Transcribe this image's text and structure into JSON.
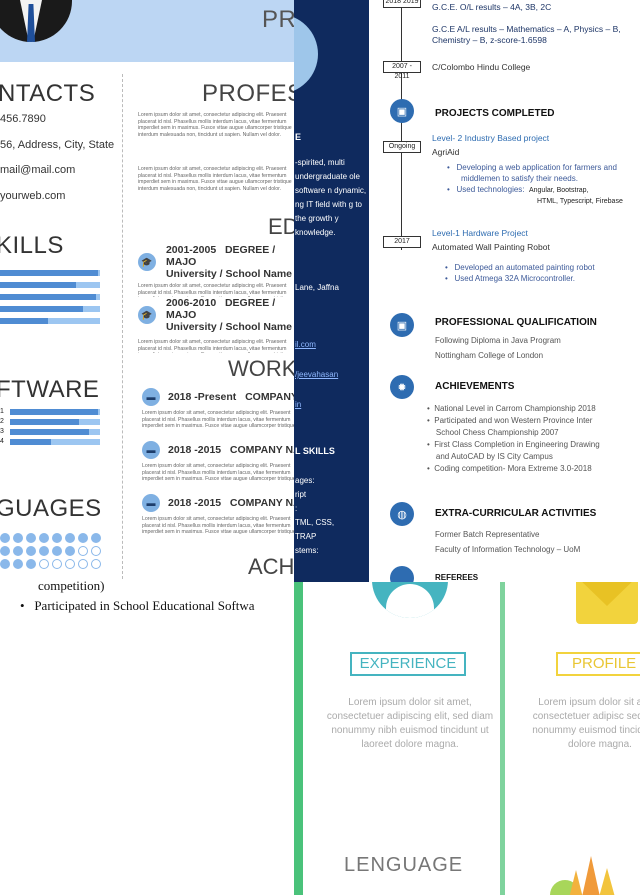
{
  "left_resume": {
    "top_label": "PR",
    "contacts_heading": "NTACTS",
    "phone": "456.7890",
    "address": "56, Address, City, State",
    "email": "mail@mail.com",
    "website": "yourweb.com",
    "skills_heading": "KILLS",
    "skills_levels": [
      0.98,
      0.76,
      0.96,
      0.83,
      0.48
    ],
    "software_heading": "FTWARE",
    "software_items": [
      {
        "label": "1",
        "level": 0.98
      },
      {
        "label": "2",
        "level": 0.77
      },
      {
        "label": "3",
        "level": 0.88
      },
      {
        "label": "4",
        "level": 0.45
      }
    ],
    "languages_heading": "GUAGES",
    "professional_heading": "PROFESS",
    "education_heading": "ED",
    "work_heading": "WORK",
    "ach_heading": "ACH",
    "lorem": "Lorem ipsum dolor sit amet, consectetur adipiscing elit. Praesent placerat id nisl. Phasellus mollis interdum lacus, vitae fermentum imperdiet sem in maximus. Fusce vitae augue ullamcorper tristique interdum malesuada non, tincidunt ut sapien. Nullam vel dolor.",
    "education": [
      {
        "years": "2001-2005",
        "degree": "DEGREE / MAJO",
        "school": "University / School Name"
      },
      {
        "years": "2006-2010",
        "degree": "DEGREE / MAJO",
        "school": "University / School Name"
      }
    ],
    "work": [
      {
        "period": "2018 -Present",
        "company": "COMPANY N"
      },
      {
        "period": "2018 -2015",
        "company": "COMPANY NAM"
      },
      {
        "period": "2018 -2015",
        "company": "COMPANY NAM"
      }
    ],
    "competition_tail": "competition)",
    "bullet_software": "Participated in School Educational Softwa"
  },
  "navy_panel": {
    "letter": "E",
    "blurb": "-spirited, multi undergraduate ole software n dynamic, ng IT field with g to the growth y knowledge.",
    "address": "Lane, Jaffna",
    "link1": "il.com",
    "link2": "/jeevahasan",
    "link3": "in",
    "skills_heading": "L SKILLS",
    "skills_lines": [
      "ages:",
      "ript",
      ":",
      "TML, CSS,",
      "TRAP",
      "stems:"
    ]
  },
  "right_resume": {
    "ol_results": "G.C.E. O/L results – 4A, 3B, 2C",
    "al_results": "G.C.E A/L results – Mathematics – A, Physics – B, Chemistry – B, z-score-1.6598",
    "school_years": "2007 - 2011",
    "school": "C/Colombo Hindu College",
    "projects_heading": "PROJECTS COMPLETED",
    "status_ongoing": "Ongoing",
    "project1_title": "Level- 2 Industry Based project",
    "project1_name": "AgriAid",
    "project1_bullets": [
      "Developing a web application for farmers and",
      "middlemen to satisfy their needs.",
      "Used technologies:"
    ],
    "project1_tech1": "Angular, Bootstrap,",
    "project1_tech2": "HTML, Typescript, Firebase",
    "year_2017": "2017",
    "project2_title": "Level-1 Hardware Project",
    "project2_name": "Automated Wall Painting Robot",
    "project2_bullets": [
      "Developed an automated painting robot",
      "Used Atmega 32A Microcontroller."
    ],
    "qual_heading": "PROFESSIONAL QUALIFICATIOIN",
    "qual_lines": [
      "Following Diploma in Java Program",
      "Nottingham College of London"
    ],
    "ach_heading": "ACHIEVEMENTS",
    "ach_bullets": [
      "National Level in Carrom Championship 2018",
      "Participated and won Western Province Inter",
      "School Chess Championship 2007",
      "First Class Completion in Engineering Drawing",
      "and AutoCAD by IS City Campus",
      "Coding competition- Mora Extreme 3.0-2018"
    ],
    "extra_heading": "EXTRA-CURRICULAR ACTIVITIES",
    "extra_lines": [
      "Former Batch Representative",
      "Faculty of Information Technology – UoM"
    ],
    "ref_heading": "REFEREES"
  },
  "green_section": {
    "experience_label": "EXPERIENCE",
    "profile_label": "PROFILE",
    "lorem_center": "Lorem ipsum dolor sit amet, consectetuer adipiscing elit, sed diam nonummy nibh euismod tincidunt ut laoreet dolore magna.",
    "lorem_right": "Lorem ipsum dolor sit amet, consectetuer adipisc sed diam nonummy euismod tincidunt ut dolore magna.",
    "language_label": "LENGUAGE"
  },
  "colors": {
    "navy": "#0f2a5e",
    "light_blue": "#bcd6f3",
    "doc_blue": "#2e6cb1",
    "green": "#4ac27a",
    "teal": "#45b4c0",
    "yellow": "#f2d33d",
    "orange": "#f09a3a"
  }
}
